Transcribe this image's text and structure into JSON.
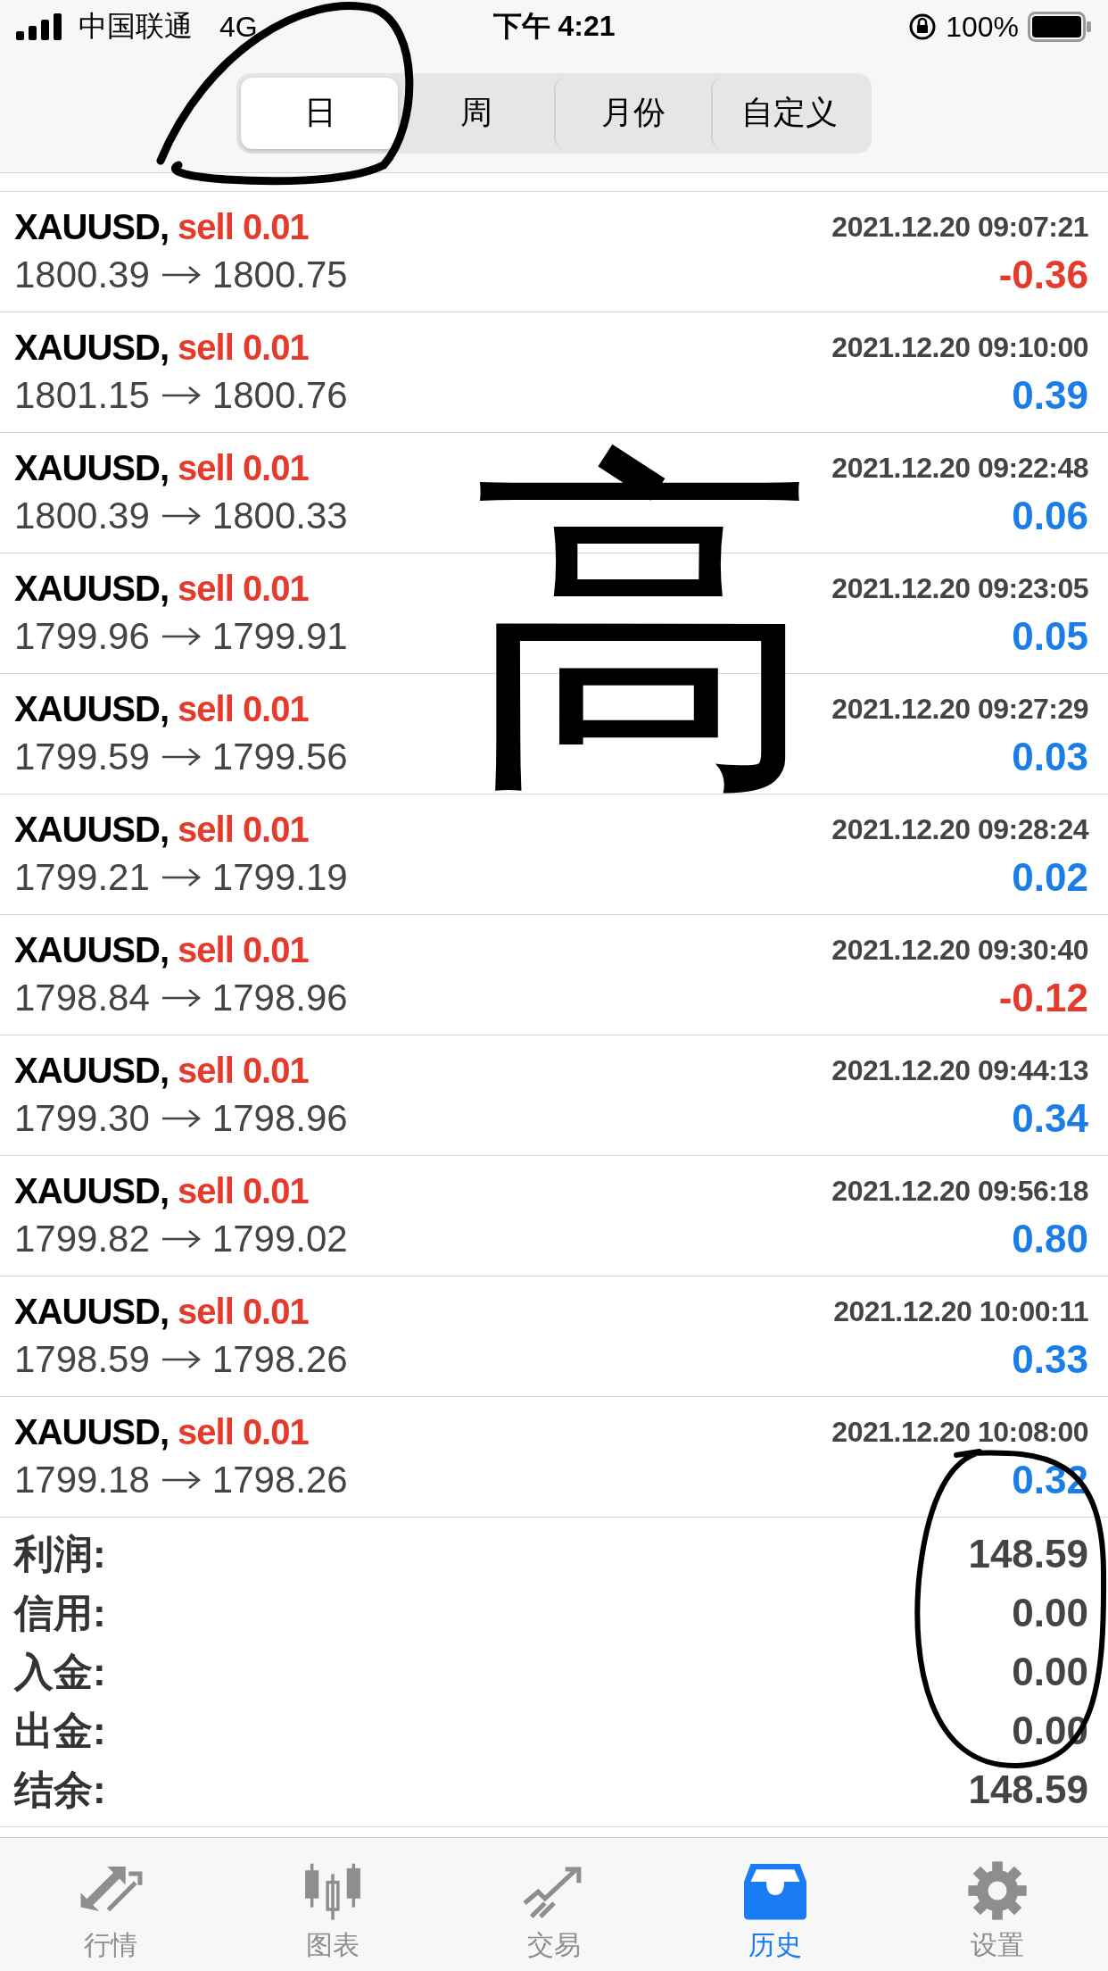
{
  "status_bar": {
    "carrier": "中国联通",
    "network": "4G",
    "time": "下午 4:21",
    "battery": "100%"
  },
  "period_tabs": [
    {
      "label": "日",
      "selected": true
    },
    {
      "label": "周",
      "selected": false
    },
    {
      "label": "月份",
      "selected": false
    },
    {
      "label": "自定义",
      "selected": false
    }
  ],
  "trades": [
    {
      "symbol": "XAUUSD,",
      "side": "sell",
      "volume": "0.01",
      "time": "2021.12.20 09:07:21",
      "open": "1800.39",
      "close": "1800.75",
      "profit": "-0.36",
      "kind": "loss"
    },
    {
      "symbol": "XAUUSD,",
      "side": "sell",
      "volume": "0.01",
      "time": "2021.12.20 09:10:00",
      "open": "1801.15",
      "close": "1800.76",
      "profit": "0.39",
      "kind": "gain"
    },
    {
      "symbol": "XAUUSD,",
      "side": "sell",
      "volume": "0.01",
      "time": "2021.12.20 09:22:48",
      "open": "1800.39",
      "close": "1800.33",
      "profit": "0.06",
      "kind": "gain"
    },
    {
      "symbol": "XAUUSD,",
      "side": "sell",
      "volume": "0.01",
      "time": "2021.12.20 09:23:05",
      "open": "1799.96",
      "close": "1799.91",
      "profit": "0.05",
      "kind": "gain"
    },
    {
      "symbol": "XAUUSD,",
      "side": "sell",
      "volume": "0.01",
      "time": "2021.12.20 09:27:29",
      "open": "1799.59",
      "close": "1799.56",
      "profit": "0.03",
      "kind": "gain"
    },
    {
      "symbol": "XAUUSD,",
      "side": "sell",
      "volume": "0.01",
      "time": "2021.12.20 09:28:24",
      "open": "1799.21",
      "close": "1799.19",
      "profit": "0.02",
      "kind": "gain"
    },
    {
      "symbol": "XAUUSD,",
      "side": "sell",
      "volume": "0.01",
      "time": "2021.12.20 09:30:40",
      "open": "1798.84",
      "close": "1798.96",
      "profit": "-0.12",
      "kind": "loss"
    },
    {
      "symbol": "XAUUSD,",
      "side": "sell",
      "volume": "0.01",
      "time": "2021.12.20 09:44:13",
      "open": "1799.30",
      "close": "1798.96",
      "profit": "0.34",
      "kind": "gain"
    },
    {
      "symbol": "XAUUSD,",
      "side": "sell",
      "volume": "0.01",
      "time": "2021.12.20 09:56:18",
      "open": "1799.82",
      "close": "1799.02",
      "profit": "0.80",
      "kind": "gain"
    },
    {
      "symbol": "XAUUSD,",
      "side": "sell",
      "volume": "0.01",
      "time": "2021.12.20 10:00:11",
      "open": "1798.59",
      "close": "1798.26",
      "profit": "0.33",
      "kind": "gain"
    },
    {
      "symbol": "XAUUSD,",
      "side": "sell",
      "volume": "0.01",
      "time": "2021.12.20 10:08:00",
      "open": "1799.18",
      "close": "1798.26",
      "profit": "0.32",
      "kind": "gain"
    }
  ],
  "summary": [
    {
      "label": "利润:",
      "value": "148.59"
    },
    {
      "label": "信用:",
      "value": "0.00"
    },
    {
      "label": "入金:",
      "value": "0.00"
    },
    {
      "label": "出金:",
      "value": "0.00"
    },
    {
      "label": "结余:",
      "value": "148.59"
    }
  ],
  "tab_bar": [
    {
      "label": "行情",
      "kind": "quotes",
      "selected": false
    },
    {
      "label": "图表",
      "kind": "chart",
      "selected": false
    },
    {
      "label": "交易",
      "kind": "trade",
      "selected": false
    },
    {
      "label": "历史",
      "kind": "history",
      "selected": true
    },
    {
      "label": "设置",
      "kind": "settings",
      "selected": false
    }
  ],
  "annotation": {
    "handwriting": "高"
  }
}
